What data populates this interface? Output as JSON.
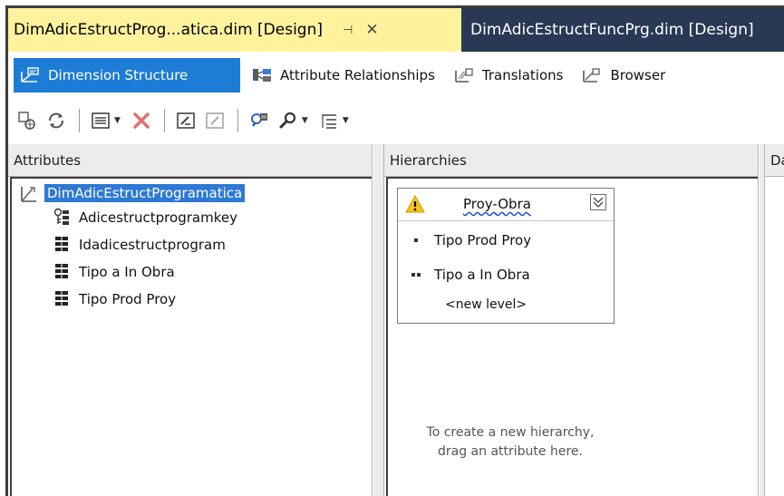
{
  "doc_tabs": {
    "active_title": "DimAdicEstructProg...atica.dim [Design]",
    "pin_glyph": "⊣",
    "close_glyph": "✕",
    "inactive_title": "DimAdicEstructFuncPrg.dim [Design]"
  },
  "designer_tabs": [
    {
      "label": "Dimension Structure",
      "icon": "dimension-structure-icon",
      "active": true
    },
    {
      "label": "Attribute Relationships",
      "icon": "attribute-relationships-icon",
      "active": false
    },
    {
      "label": "Translations",
      "icon": "translations-icon",
      "active": false
    },
    {
      "label": "Browser",
      "icon": "browser-icon",
      "active": false
    }
  ],
  "toolbar": {
    "icons": [
      "process-icon",
      "refresh-icon",
      "show-table-icon",
      "delete-icon",
      "new-hierarchy-icon",
      "rename-icon",
      "zoom-icon",
      "find-icon",
      "view-icon"
    ]
  },
  "attributes_pane": {
    "header": "Attributes",
    "root": "DimAdicEstructProgramatica",
    "items": [
      {
        "label": "Adicestructprogramkey",
        "icon": "key-attribute-icon"
      },
      {
        "label": "Idadicestructprogram",
        "icon": "attribute-icon"
      },
      {
        "label": "Tipo a In Obra",
        "icon": "attribute-icon"
      },
      {
        "label": "Tipo Prod Proy",
        "icon": "attribute-icon"
      }
    ]
  },
  "hierarchies_pane": {
    "header": "Hierarchies",
    "hierarchy": {
      "name": "Proy-Obra",
      "levels": [
        "Tipo Prod Proy",
        "Tipo a In Obra"
      ],
      "new_level": "<new level>"
    },
    "hint": "To create a new hierarchy, drag an attribute here."
  },
  "dsv_pane": {
    "header": "Da"
  },
  "colors": {
    "active_doc_tab": "#fff29d",
    "tab_strip": "#293955",
    "selected_designer_tab": "#1d7cd6",
    "tree_selection": "#2e79d4"
  }
}
